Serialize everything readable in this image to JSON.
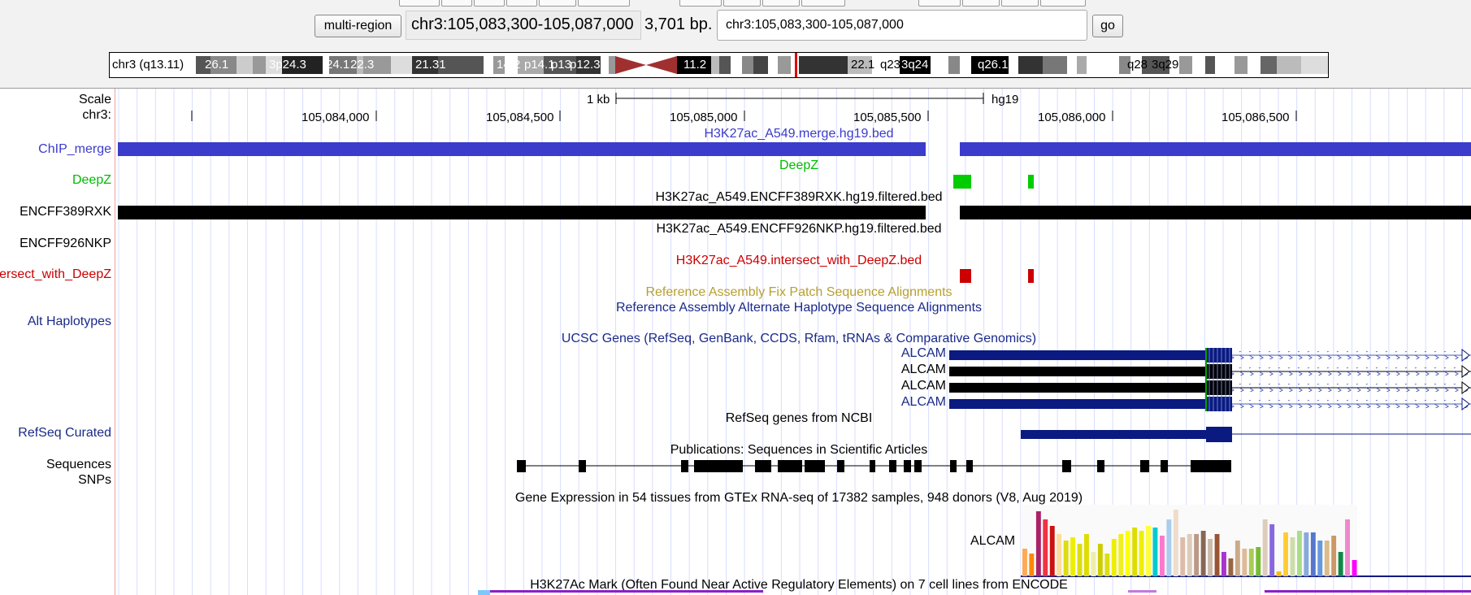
{
  "controls": {
    "multi_region_label": "multi-region",
    "position": "chr3:105,083,300-105,087,000",
    "size": "3,701 bp.",
    "search_value": "chr3:105,083,300-105,087,000",
    "go_label": "go"
  },
  "ideogram": {
    "chrom_label": "chr3 (q13.11)",
    "bands": [
      "26.1",
      "3p24.3",
      "24.1",
      "22.3",
      "21.31",
      "14.2",
      "p14.1",
      "p13",
      "p12.3",
      "11.2",
      "22.1",
      "q23",
      "3q24",
      "q26.1",
      "q28",
      "3q29"
    ]
  },
  "ruler": {
    "scale_label": "Scale",
    "chrom_label": "chr3:",
    "scale_text": "1 kb",
    "assembly": "hg19",
    "ticks": [
      "105,084,000",
      "105,084,500",
      "105,085,000",
      "105,085,500",
      "105,086,000",
      "105,086,500"
    ]
  },
  "track_labels": {
    "chip_merge": "ChIP_merge",
    "deepz": "DeepZ",
    "encff389": "ENCFF389RXK",
    "encff926": "ENCFF926NKP",
    "intersect": "ersect_with_DeepZ",
    "alt_haplotypes": "Alt Haplotypes",
    "refseq": "RefSeq Curated",
    "sequences": "Sequences",
    "snps": "SNPs"
  },
  "track_titles": {
    "chip_merge": "H3K27ac_A549.merge.hg19.bed",
    "deepz": "DeepZ",
    "encff389": "H3K27ac_A549.ENCFF389RXK.hg19.filtered.bed",
    "encff926": "H3K27ac_A549.ENCFF926NKP.hg19.filtered.bed",
    "intersect": "H3K27ac_A549.intersect_with_DeepZ.bed",
    "fix_patch": "Reference Assembly Fix Patch Sequence Alignments",
    "alt_hap": "Reference Assembly Alternate Haplotype Sequence Alignments",
    "ucsc_genes": "UCSC Genes (RefSeq, GenBank, CCDS, Rfam, tRNAs & Comparative Genomics)",
    "refseq": "RefSeq genes from NCBI",
    "publications": "Publications: Sequences in Scientific Articles",
    "gtex": "Gene Expression in 54 tissues from GTEx RNA-seq of 17382 samples, 948 donors (V8, Aug 2019)",
    "h3k27ac": "H3K27Ac Mark (Often Found Near Active Regulatory Elements) on 7 cell lines from ENCODE"
  },
  "genes": {
    "alcam_rows": [
      "ALCAM",
      "ALCAM",
      "ALCAM",
      "ALCAM"
    ],
    "gtex_gene": "ALCAM"
  },
  "colors": {
    "chip_blue": "#3b3bcc",
    "deepz_green": "#00cc00",
    "intersect_red": "#cc0000",
    "gene_navy": "#0a1a80",
    "fix_patch_gold": "#b8a030"
  }
}
